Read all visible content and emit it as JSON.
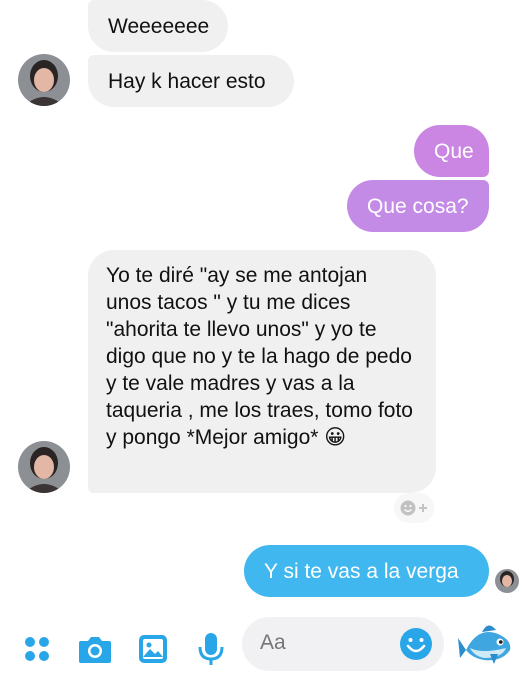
{
  "messages": [
    {
      "text": "Weeeeeee"
    },
    {
      "text": "Hay k hacer esto"
    },
    {
      "text": "Que"
    },
    {
      "text": "Que cosa?"
    },
    {
      "text": "Yo te diré \"ay se me antojan unos tacos \" y tu me dices \"ahorita te llevo unos\" y yo te digo que no y te la hago de pedo y te vale madres y vas a la taqueria , me los traes, tomo foto y pongo *Mejor amigo* 😀"
    },
    {
      "text": "Y si te vas a la verga"
    }
  ],
  "composer": {
    "placeholder": "Aa"
  },
  "icons": [
    "menu-dots-icon",
    "camera-icon",
    "gallery-icon",
    "microphone-icon",
    "emoji-icon",
    "fish-emoji-icon",
    "add-reaction-icon"
  ],
  "colors": {
    "incoming_bubble": "#f1f0f0",
    "outgoing_purple": "#c983e0",
    "outgoing_blue": "#3fb9f0",
    "accent_blue": "#29a6e8"
  }
}
